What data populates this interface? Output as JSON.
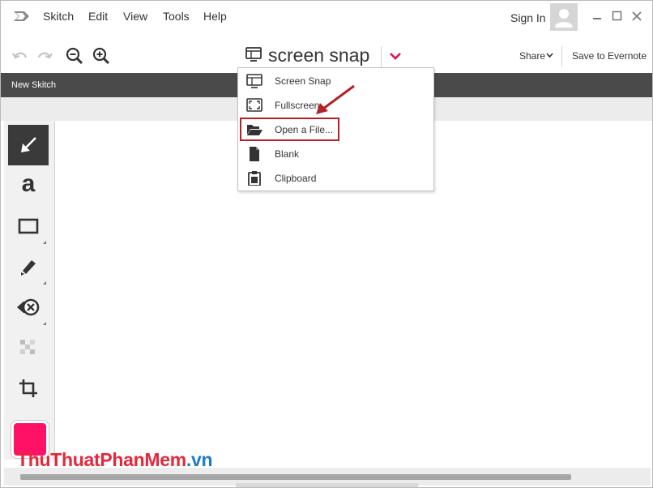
{
  "menubar": {
    "items": [
      "Skitch",
      "Edit",
      "View",
      "Tools",
      "Help"
    ],
    "sign_in": "Sign In"
  },
  "toolbar": {
    "snap_title": "screen snap",
    "share": "Share",
    "save": "Save to Evernote"
  },
  "tabbar": {
    "label": "New Skitch"
  },
  "dropdown": {
    "items": [
      {
        "label": "Screen Snap",
        "icon": "monitor-icon"
      },
      {
        "label": "Fullscreen",
        "icon": "fullscreen-icon"
      },
      {
        "label": "Open a File...",
        "icon": "folder-open-icon"
      },
      {
        "label": "Blank",
        "icon": "blank-file-icon"
      },
      {
        "label": "Clipboard",
        "icon": "clipboard-icon"
      }
    ],
    "highlighted": "Open a File..."
  },
  "tools": [
    "arrow-tool",
    "text-tool",
    "rectangle-tool",
    "marker-tool",
    "stamp-tool",
    "pixelate-tool",
    "crop-tool"
  ],
  "tool_text": "a",
  "colors": {
    "accent": "#e0104f",
    "swatch": "#ff1166",
    "annotation": "#b52025",
    "tabbar": "#4a4a4a"
  },
  "watermark": {
    "part1": "ThuThuat",
    "part2": "PhanMem",
    "part3": ".vn"
  }
}
